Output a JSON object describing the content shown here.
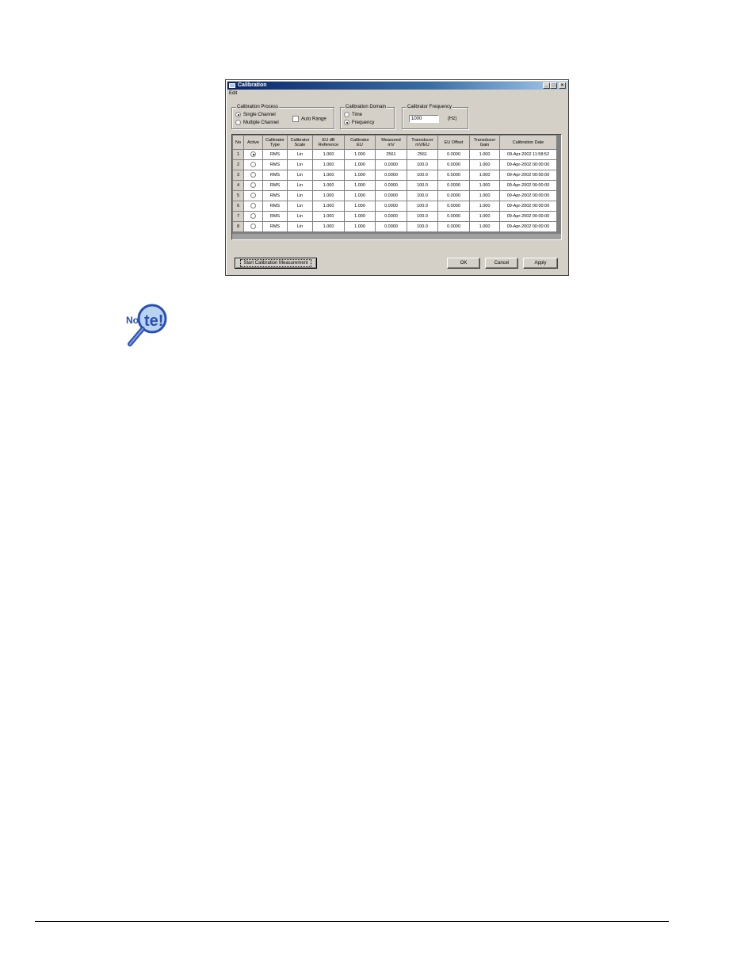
{
  "window": {
    "title": "Calibration",
    "menu": "Edit"
  },
  "calibration_process": {
    "label": "Calibration Process",
    "options": [
      "Single Channel",
      "Multiple Channel"
    ],
    "selected": "Single Channel",
    "auto_range_label": "Auto Range",
    "auto_range_checked": false
  },
  "calibration_domain": {
    "label": "Calibration Domain",
    "options": [
      "Time",
      "Frequency"
    ],
    "selected": "Frequency"
  },
  "calibrator_frequency": {
    "label": "Calibrator Frequency",
    "value": "1000",
    "unit": "(Hz)"
  },
  "table": {
    "headers": [
      [
        "No"
      ],
      [
        "Active"
      ],
      [
        "Calibrator",
        "Type"
      ],
      [
        "Calibrator",
        "Scale"
      ],
      [
        "EU dB",
        "Reference"
      ],
      [
        "Calibrator",
        "EU"
      ],
      [
        "Measured",
        "mV"
      ],
      [
        "Transducer",
        "mV/EU"
      ],
      [
        "EU Offset"
      ],
      [
        "Transducer",
        "Gain"
      ],
      [
        "Calibration Date"
      ]
    ],
    "rows": [
      {
        "no": "1",
        "active": true,
        "type": "RMS",
        "scale": "Lin",
        "ref": "1.000",
        "eu": "1.000",
        "measured": "2561",
        "mveu": "2561",
        "offset": "0.0000",
        "gain": "1.000",
        "date": "09-Apr-2002 11:58:52"
      },
      {
        "no": "2",
        "active": false,
        "type": "RMS",
        "scale": "Lin",
        "ref": "1.000",
        "eu": "1.000",
        "measured": "0.0000",
        "mveu": "100.0",
        "offset": "0.0000",
        "gain": "1.000",
        "date": "09-Apr-2002 00:00:00"
      },
      {
        "no": "3",
        "active": false,
        "type": "RMS",
        "scale": "Lin",
        "ref": "1.000",
        "eu": "1.000",
        "measured": "0.0000",
        "mveu": "100.0",
        "offset": "0.0000",
        "gain": "1.000",
        "date": "09-Apr-2002 00:00:00"
      },
      {
        "no": "4",
        "active": false,
        "type": "RMS",
        "scale": "Lin",
        "ref": "1.000",
        "eu": "1.000",
        "measured": "0.0000",
        "mveu": "100.0",
        "offset": "0.0000",
        "gain": "1.000",
        "date": "09-Apr-2002 00:00:00"
      },
      {
        "no": "5",
        "active": false,
        "type": "RMS",
        "scale": "Lin",
        "ref": "1.000",
        "eu": "1.000",
        "measured": "0.0000",
        "mveu": "100.0",
        "offset": "0.0000",
        "gain": "1.000",
        "date": "09-Apr-2002 00:00:00"
      },
      {
        "no": "6",
        "active": false,
        "type": "RMS",
        "scale": "Lin",
        "ref": "1.000",
        "eu": "1.000",
        "measured": "0.0000",
        "mveu": "100.0",
        "offset": "0.0000",
        "gain": "1.000",
        "date": "09-Apr-2002 00:00:00"
      },
      {
        "no": "7",
        "active": false,
        "type": "RMS",
        "scale": "Lin",
        "ref": "1.000",
        "eu": "1.000",
        "measured": "0.0000",
        "mveu": "100.0",
        "offset": "0.0000",
        "gain": "1.000",
        "date": "09-Apr-2002 00:00:00"
      },
      {
        "no": "8",
        "active": false,
        "type": "RMS",
        "scale": "Lin",
        "ref": "1.000",
        "eu": "1.000",
        "measured": "0.0000",
        "mveu": "100.0",
        "offset": "0.0000",
        "gain": "1.000",
        "date": "09-Apr-2002 00:00:00"
      }
    ]
  },
  "buttons": {
    "start": "Start Calibration Measurement",
    "ok": "OK",
    "cancel": "Cancel",
    "apply": "Apply"
  },
  "note_icon": {
    "text": "Note!",
    "icon": "magnifier-icon",
    "color_primary": "#2a4fb0",
    "color_glass": "#b8d4f0"
  }
}
